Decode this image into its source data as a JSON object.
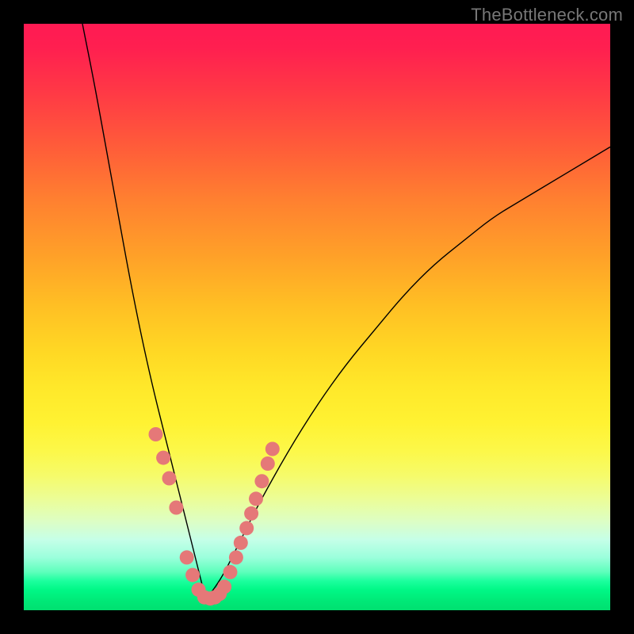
{
  "watermark": "TheBottleneck.com",
  "colors": {
    "frame_bg": "#000000",
    "curve_stroke": "#000000",
    "dot_fill": "#e57878",
    "gradient_top": "#ff1a53",
    "gradient_bottom": "#00e070"
  },
  "chart_data": {
    "type": "line",
    "title": "",
    "xlabel": "",
    "ylabel": "",
    "xlim": [
      0,
      100
    ],
    "ylim": [
      0,
      100
    ],
    "grid": false,
    "note": "V-shaped bottleneck curve. Coordinates are percentages of the plot area (x: left→right 0–100, y: 0 at bottom to 100 at top). Curve minimum near x≈31, y≈2.",
    "series": [
      {
        "name": "bottleneck-curve",
        "x": [
          10,
          12,
          14,
          16,
          18,
          20,
          22,
          24,
          26,
          28,
          30,
          31,
          32,
          34,
          36,
          38,
          40,
          45,
          50,
          55,
          60,
          65,
          70,
          75,
          80,
          85,
          90,
          95,
          100
        ],
        "y": [
          100,
          90,
          79,
          68,
          57,
          47,
          38,
          30,
          22,
          14,
          6,
          2,
          3,
          6,
          10,
          14,
          18,
          27,
          35,
          42,
          48,
          54,
          59,
          63,
          67,
          70,
          73,
          76,
          79
        ]
      }
    ],
    "highlight_points": {
      "name": "pink-dots",
      "note": "Clusters of salmon dots near the valley on both sides and along the flat bottom.",
      "x": [
        22.5,
        23.8,
        24.8,
        26.0,
        27.8,
        28.8,
        29.8,
        30.8,
        31.8,
        32.6,
        33.4,
        34.2,
        35.2,
        36.2,
        37.0,
        38.0,
        38.8,
        39.6,
        40.6,
        41.6,
        42.4
      ],
      "y": [
        30.0,
        26.0,
        22.5,
        17.5,
        9.0,
        6.0,
        3.5,
        2.2,
        2.0,
        2.2,
        2.8,
        4.0,
        6.5,
        9.0,
        11.5,
        14.0,
        16.5,
        19.0,
        22.0,
        25.0,
        27.5
      ]
    }
  }
}
